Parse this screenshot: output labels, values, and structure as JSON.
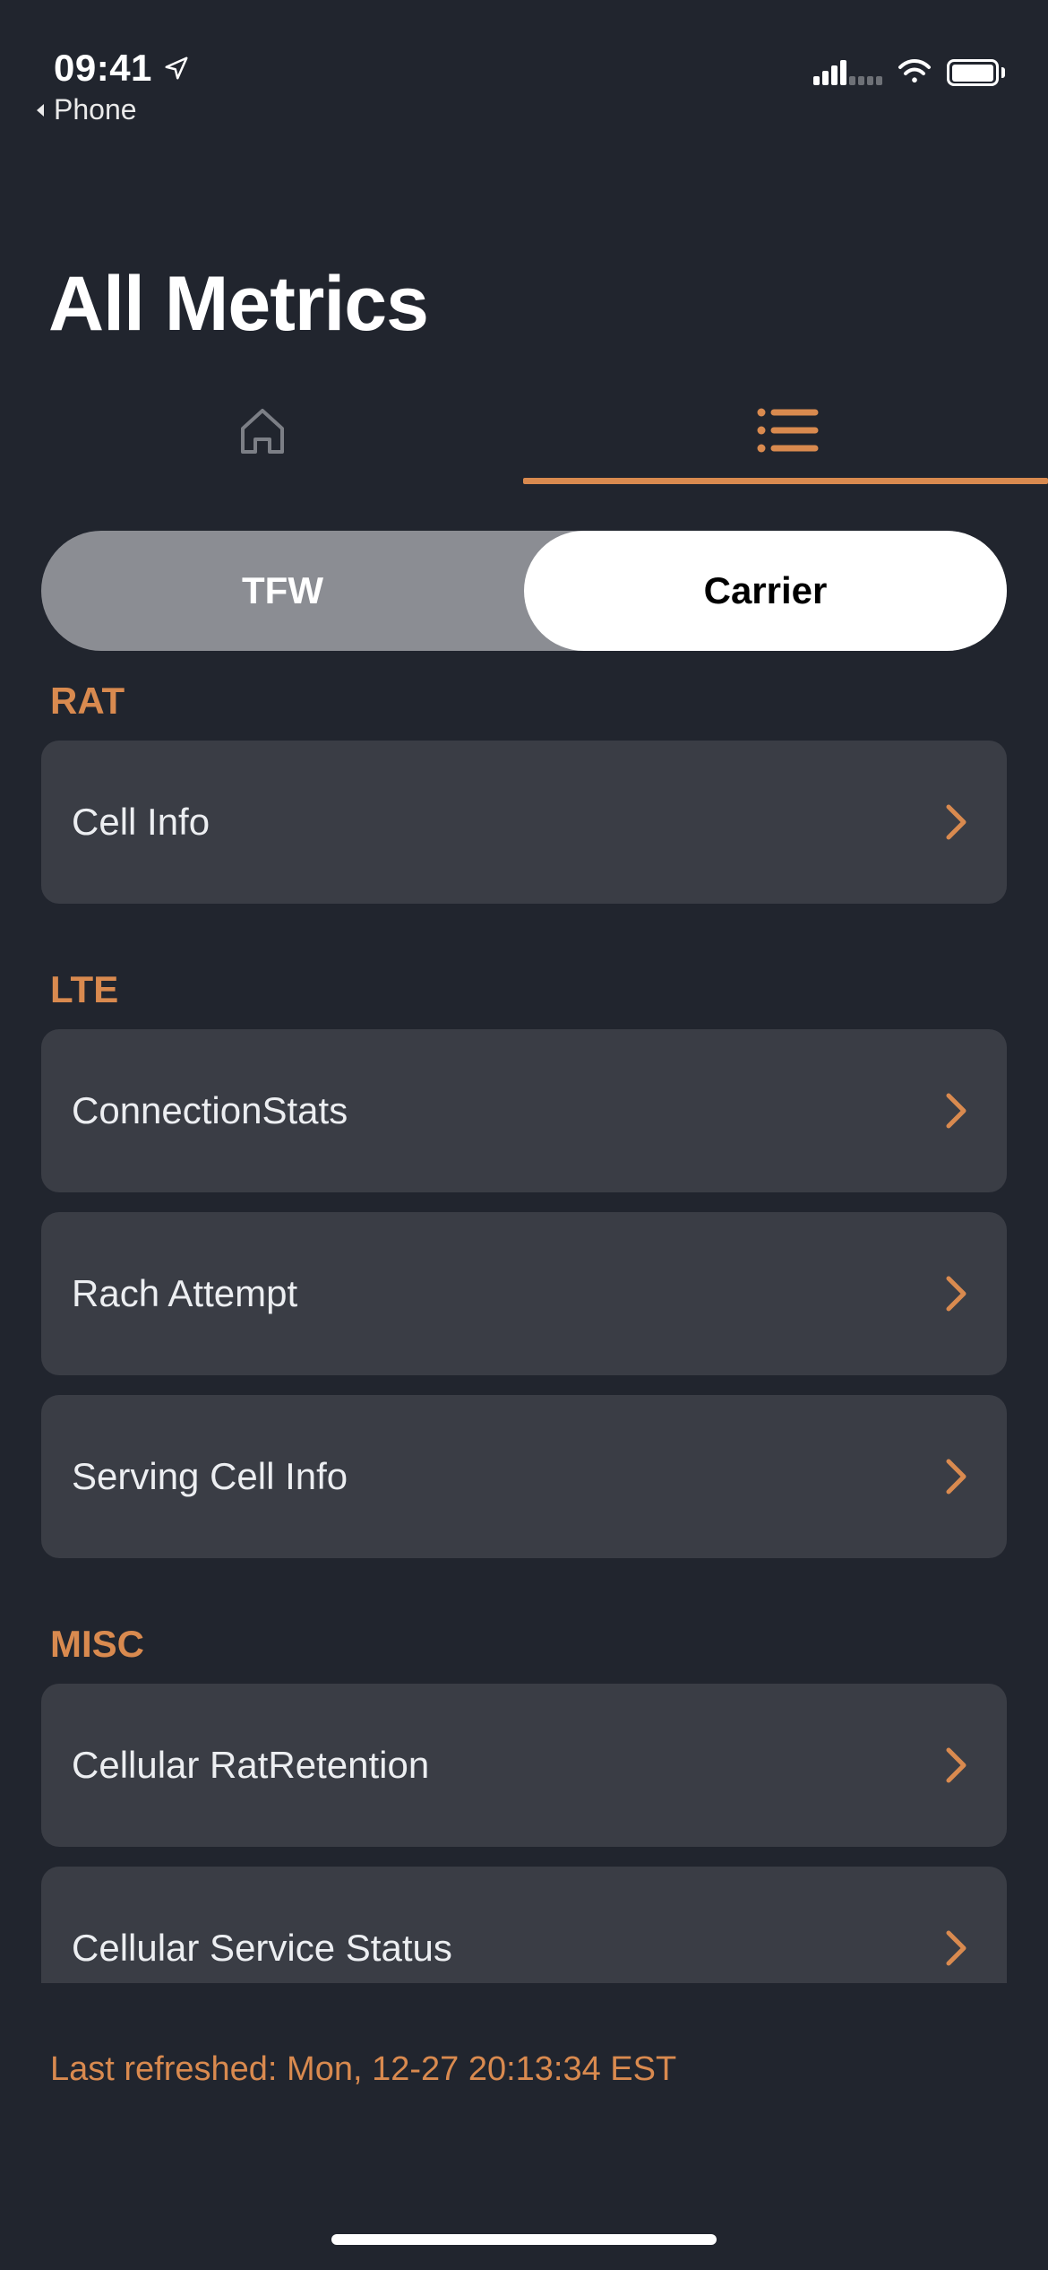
{
  "status": {
    "time": "09:41",
    "back_app": "Phone"
  },
  "page": {
    "title": "All Metrics"
  },
  "segmented": {
    "left": "TFW",
    "right": "Carrier",
    "active": "right"
  },
  "sections": [
    {
      "header": "RAT",
      "items": [
        {
          "label": "Cell Info"
        }
      ]
    },
    {
      "header": "LTE",
      "items": [
        {
          "label": "ConnectionStats"
        },
        {
          "label": "Rach Attempt"
        },
        {
          "label": "Serving Cell Info"
        }
      ]
    },
    {
      "header": "MISC",
      "items": [
        {
          "label": "Cellular RatRetention"
        },
        {
          "label": "Cellular Service Status"
        }
      ]
    }
  ],
  "footer": {
    "last_refreshed": "Last refreshed: Mon, 12-27 20:13:34 EST"
  },
  "colors": {
    "accent": "#d98a4f",
    "bg": "#21252e",
    "cell_bg": "#3a3d45"
  }
}
